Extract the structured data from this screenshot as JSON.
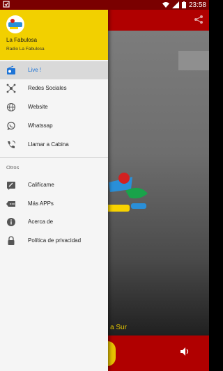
{
  "status_bar": {
    "time": "23:58",
    "icons": [
      "notification-icon",
      "wifi-icon",
      "signal-icon",
      "battery-icon"
    ]
  },
  "drawer": {
    "header": {
      "title": "La Fabulosa",
      "subtitle": "Radio La Fabulosa",
      "background": "#f2d000"
    },
    "items": [
      {
        "label": "Live !",
        "icon": "radio-icon",
        "active": true
      },
      {
        "label": "Redes Sociales",
        "icon": "network-icon",
        "active": false
      },
      {
        "label": "Website",
        "icon": "globe-icon",
        "active": false
      },
      {
        "label": "Whatssap",
        "icon": "whatsapp-icon",
        "active": false
      },
      {
        "label": "Llamar a Cabina",
        "icon": "phone-icon",
        "active": false
      }
    ],
    "section_label": "Otros",
    "other_items": [
      {
        "label": "Califícame",
        "icon": "rate-icon"
      },
      {
        "label": "Más APPs",
        "icon": "more-apps-icon"
      },
      {
        "label": "Acerca de",
        "icon": "info-icon"
      },
      {
        "label": "Política de privacidad",
        "icon": "lock-icon"
      }
    ],
    "active_color": "#1e74d6"
  },
  "background_app": {
    "caption": "a Sur",
    "accent": "#b00000"
  }
}
